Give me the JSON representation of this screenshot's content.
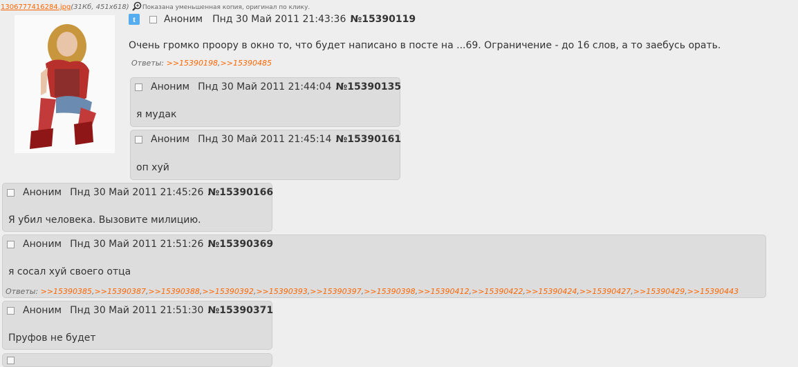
{
  "file_info": {
    "filename": "1306777416284.jpg",
    "meta": "(31Кб, 451x618)",
    "note": "Показана уменьшенная копия, оригинал по клику."
  },
  "op": {
    "author": "Аноним",
    "date": "Пнд 30 Май 2011 21:43:36",
    "number": "№15390119",
    "message": "Очень громко проору в окно то, что будет написано в посте на ...69. Ограничение - до 16 слов, а то заебусь орать.",
    "answers_label": "Ответы:",
    "answers": [
      ">>15390198",
      ">>15390485"
    ]
  },
  "posts": [
    {
      "author": "Аноним",
      "date": "Пнд 30 Май 2011 21:44:04",
      "number": "№15390135",
      "message": "я мудак"
    },
    {
      "author": "Аноним",
      "date": "Пнд 30 Май 2011 21:45:14",
      "number": "№15390161",
      "message": "оп хуй"
    },
    {
      "author": "Аноним",
      "date": "Пнд 30 Май 2011 21:45:26",
      "number": "№15390166",
      "message": "Я убил человека. Вызовите милицию."
    },
    {
      "author": "Аноним",
      "date": "Пнд 30 Май 2011 21:51:26",
      "number": "№15390369",
      "message": "я сосал хуй своего отца",
      "answers_label": "Ответы:",
      "answers": [
        ">>15390385",
        ">>15390387",
        ">>15390388",
        ">>15390392",
        ">>15390393",
        ">>15390397",
        ">>15390398",
        ">>15390412",
        ">>15390422",
        ">>15390424",
        ">>15390427",
        ">>15390429",
        ">>15390443"
      ]
    },
    {
      "author": "Аноним",
      "date": "Пнд 30 Май 2011 21:51:30",
      "number": "№15390371",
      "message": "Пруфов не будет"
    }
  ],
  "icons": {
    "twitter": "twitter-icon",
    "zoom": "magnifier-icon",
    "checkbox": "checkbox"
  },
  "colors": {
    "link": "#ff6600",
    "reply_bg": "#dddddd",
    "page_bg": "#eeeeee"
  }
}
